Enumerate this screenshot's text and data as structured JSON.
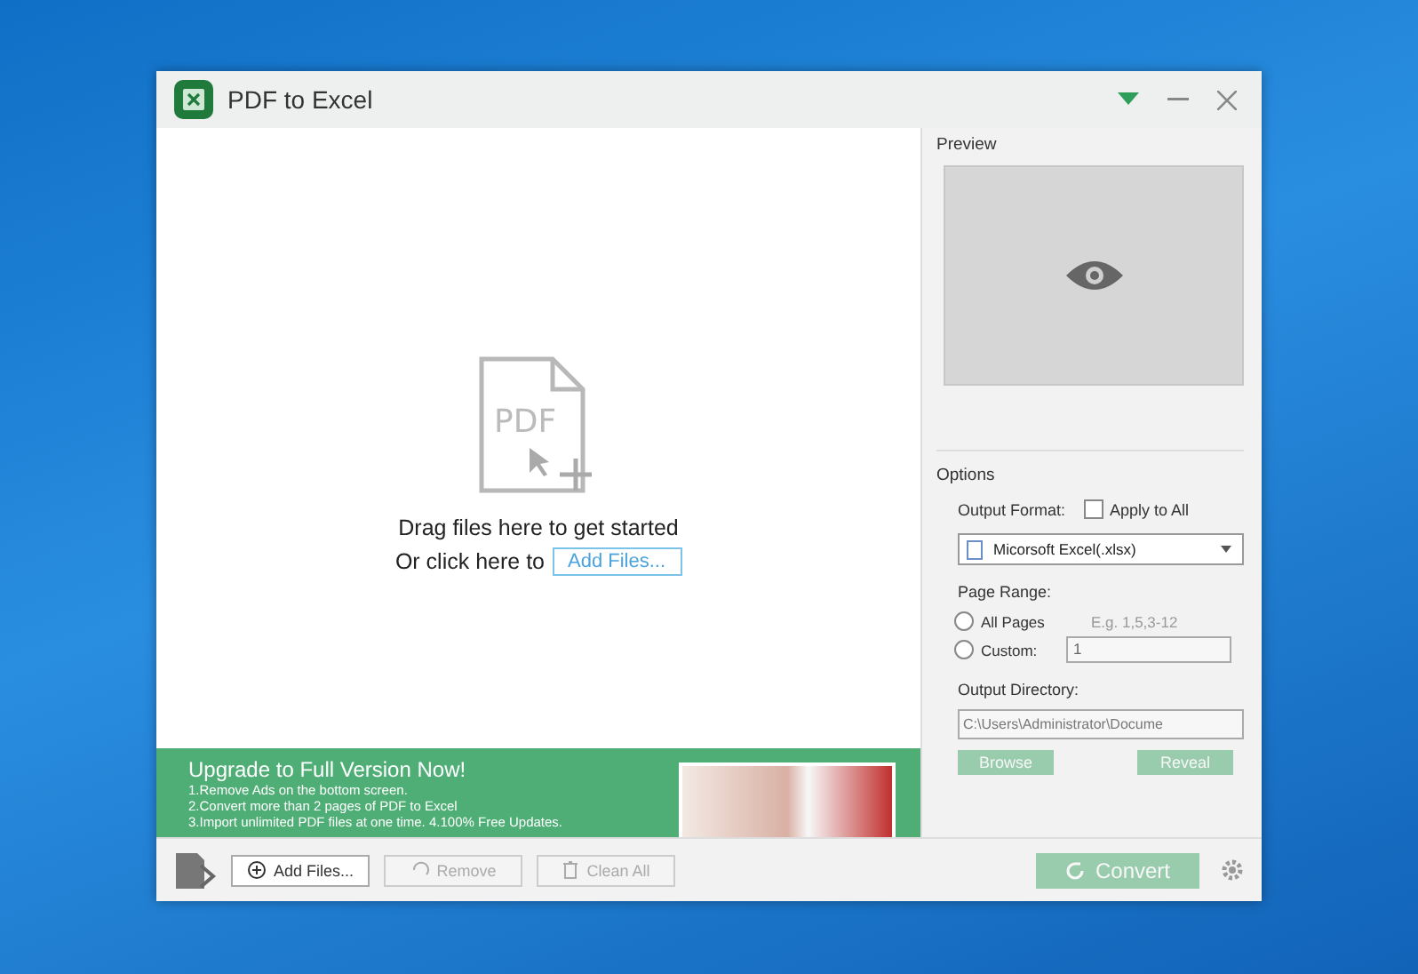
{
  "window": {
    "title": "PDF to Excel"
  },
  "drop_area": {
    "icon_text": "PDF",
    "line_1": "Drag files here to get started",
    "line_2": "Or click here to",
    "add_button": "Add Files..."
  },
  "banner": {
    "title": "Upgrade to Full Version Now!",
    "lines": [
      "1.Remove Ads on the bottom screen.",
      "2.Convert more than 2 pages of PDF to Excel",
      "3.Import unlimited PDF files at one time. 4.100% Free Updates."
    ]
  },
  "toolbar": {
    "buttons": [
      {
        "label": "Add Files...",
        "kind": "add",
        "disabled": false
      },
      {
        "label": "Remove",
        "kind": "remove",
        "disabled": true
      },
      {
        "label": "Clean All",
        "kind": "clean",
        "disabled": true
      }
    ],
    "convert": {
      "label": "Convert",
      "disabled": true
    }
  },
  "preview": {
    "label": "Preview"
  },
  "options": {
    "title": "Options",
    "output_format_label": "Output Format:",
    "apply_to_all": {
      "label": "Apply to All",
      "checked": false
    },
    "format_value": "Micorsoft Excel(.xlsx)",
    "page_range_label": "Page Range:",
    "ranges": [
      {
        "label": "All Pages",
        "selected": false
      },
      {
        "label": "Custom:",
        "selected": false
      }
    ],
    "range_hint": "E.g. 1,5,3-12",
    "custom_value": "1",
    "output_directory_label": "Output Directory:",
    "directory_value": "C:\\Users\\Administrator\\Docume",
    "buttons": [
      {
        "label": "Browse",
        "disabled": true
      },
      {
        "label": "Reveal",
        "disabled": true
      }
    ]
  }
}
